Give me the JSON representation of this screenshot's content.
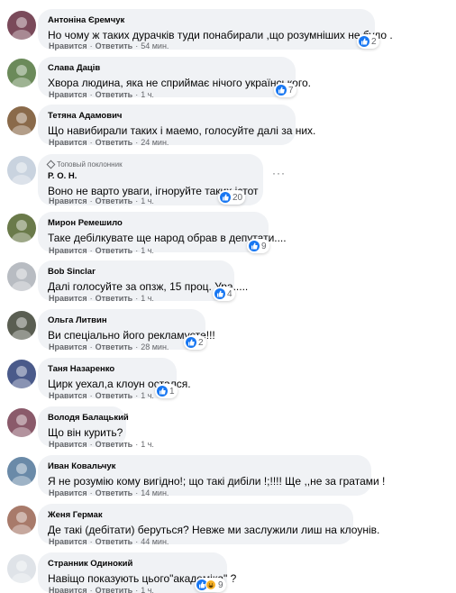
{
  "actions": {
    "like": "Нравится",
    "reply": "Ответить",
    "sep": "·"
  },
  "more_label": "···",
  "comments": [
    {
      "author": "Антоніна Єремчук",
      "text": "Но чому ж таких дурачків туди понабирали ,що розумніших не було .",
      "time": "54 мин.",
      "reactions": "2"
    },
    {
      "author": "Слава Даців",
      "text": "Хвора людина, яка не сприймає нічого українського.",
      "time": "1 ч.",
      "reactions": "7"
    },
    {
      "author": "Тетяна Адамович",
      "text": "Що навибирали таких і маемо, голосуйте далі за них.",
      "time": "24 мин.",
      "reactions": ""
    },
    {
      "badge": "Топовый поклонник",
      "author": "Р. О. Н.",
      "text": "Воно не варто уваги, ігноруйте таких істот",
      "time": "1 ч.",
      "reactions": "20"
    },
    {
      "author": "Мирон Ремешило",
      "text": "Таке дебілкувате ще народ обрав в депутати....",
      "time": "1 ч.",
      "reactions": "9"
    },
    {
      "author": "Bob Sinclar",
      "text": "Далі голосуйте за опзж, 15 проц. Ура.....",
      "time": "1 ч.",
      "reactions": "4"
    },
    {
      "author": "Ольга Литвин",
      "text": "Ви спеціально його рекламуєте!!!",
      "time": "28 мин.",
      "reactions": "2"
    },
    {
      "author": "Таня Назаренко",
      "text": "Цирк уехал,а клоун остался.",
      "time": "1 ч.",
      "reactions": "1"
    },
    {
      "author": "Володя Балацький",
      "text": "Що він курить?",
      "time": "1 ч.",
      "reactions": ""
    },
    {
      "author": "Иван Ковальчук",
      "text": "Я не розумію кому вигідно!; що такі дибіли !;!!!! Ще ,,не за гратами !",
      "time": "14 мин.",
      "reactions": ""
    },
    {
      "author": "Женя Гермак",
      "text": "Де такі (дебітати) беруться? Невже ми заслужили лиш на клоунів.",
      "time": "44 мин.",
      "reactions": ""
    },
    {
      "author": "Странник Одинокий",
      "text": "Навіщо показують цього\"академіка\" ?",
      "time": "1 ч.",
      "reactions": "9"
    }
  ],
  "avatar_colors": [
    "#7a4a5a",
    "#6b8a5a",
    "#8a6a4a",
    "#c9d3df",
    "#6a7a4a",
    "#b8bcc2",
    "#5a5e52",
    "#4a5a8a",
    "#8a5a6a",
    "#6a8aa8",
    "#a87a6a",
    "#dfe3e8"
  ]
}
